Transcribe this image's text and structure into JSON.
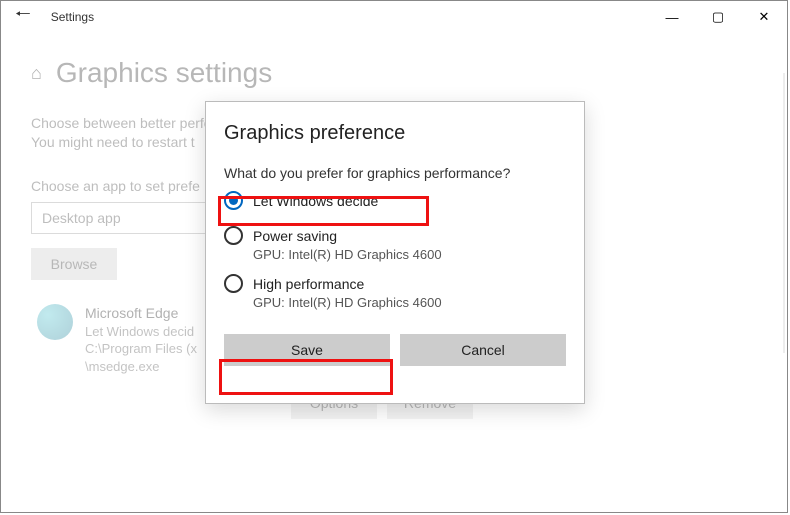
{
  "titlebar": {
    "label": "Settings"
  },
  "bg": {
    "heading": "Graphics settings",
    "desc1": "Choose between better performance or",
    "desc2": "You might need to restart t",
    "choose_label": "Choose an app to set prefe",
    "dropdown_value": "Desktop app",
    "browse": "Browse",
    "app": {
      "name": "Microsoft Edge",
      "pref": "Let Windows decid",
      "path1": "C:\\Program Files (x",
      "path2": "\\msedge.exe"
    },
    "options": "Options",
    "remove": "Remove"
  },
  "modal": {
    "title": "Graphics preference",
    "question": "What do you prefer for graphics performance?",
    "opt1": "Let Windows decide",
    "opt2": "Power saving",
    "opt2_gpu": "GPU: Intel(R) HD Graphics 4600",
    "opt3": "High performance",
    "opt3_gpu": "GPU: Intel(R) HD Graphics 4600",
    "save": "Save",
    "cancel": "Cancel"
  }
}
